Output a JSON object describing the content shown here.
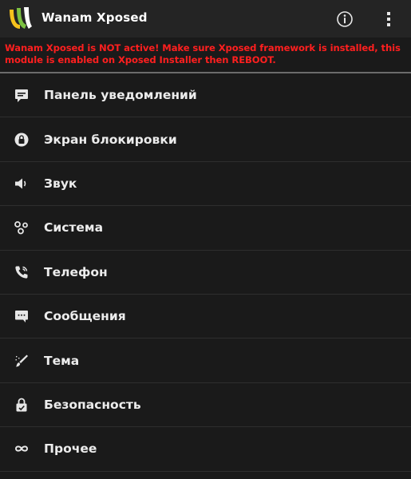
{
  "app": {
    "title": "Wanam Xposed"
  },
  "action_bar": {
    "icons": [
      "app-logo-icon",
      "info-icon",
      "overflow-menu-icon"
    ]
  },
  "warning": {
    "text": "Wanam Xposed is NOT active! Make sure Xposed framework is installed, this module is enabled on Xposed Installer then REBOOT.",
    "color": "#ff1f1f"
  },
  "menu": {
    "items": [
      {
        "label": "Панель уведомлений",
        "icon": "notification-panel-icon"
      },
      {
        "label": "Экран блокировки",
        "icon": "lock-screen-icon"
      },
      {
        "label": "Звук",
        "icon": "speaker-icon"
      },
      {
        "label": "Система",
        "icon": "system-icon"
      },
      {
        "label": "Телефон",
        "icon": "phone-icon"
      },
      {
        "label": "Сообщения",
        "icon": "messages-icon"
      },
      {
        "label": "Тема",
        "icon": "theme-icon"
      },
      {
        "label": "Безопасность",
        "icon": "security-icon"
      },
      {
        "label": "Прочее",
        "icon": "infinity-icon"
      }
    ]
  },
  "colors": {
    "background": "#1a1a1a",
    "action_bar": "#242424",
    "text": "#ececec",
    "warning": "#ff1f1f",
    "logo_green": "#7cc142",
    "logo_yellow": "#f6c21c"
  }
}
